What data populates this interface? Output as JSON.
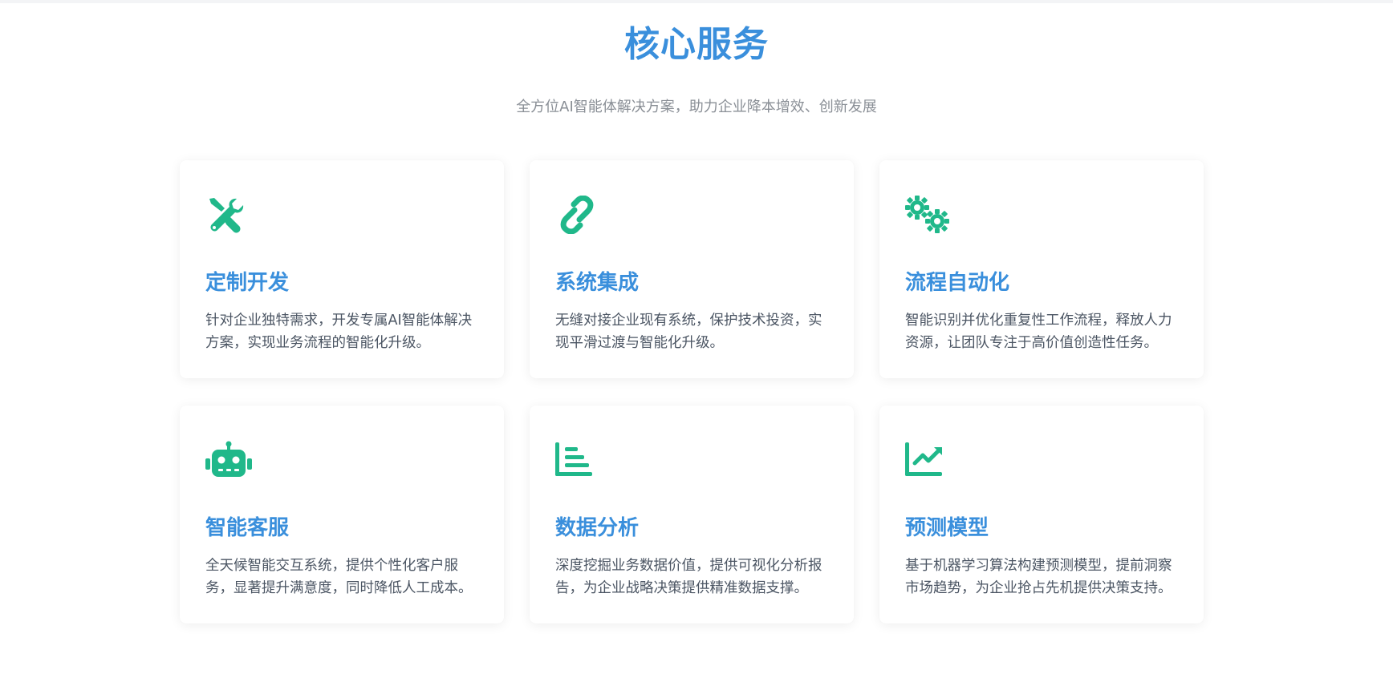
{
  "section": {
    "title": "核心服务",
    "subtitle": "全方位AI智能体解决方案，助力企业降本增效、创新发展"
  },
  "accent_color": "#3a8fdc",
  "icon_color": "#20b88a",
  "services": [
    {
      "icon": "tools-icon",
      "title": "定制开发",
      "description": "针对企业独特需求，开发专属AI智能体解决方案，实现业务流程的智能化升级。"
    },
    {
      "icon": "link-icon",
      "title": "系统集成",
      "description": "无缝对接企业现有系统，保护技术投资，实现平滑过渡与智能化升级。"
    },
    {
      "icon": "gears-icon",
      "title": "流程自动化",
      "description": "智能识别并优化重复性工作流程，释放人力资源，让团队专注于高价值创造性任务。"
    },
    {
      "icon": "robot-icon",
      "title": "智能客服",
      "description": "全天候智能交互系统，提供个性化客户服务，显著提升满意度，同时降低人工成本。"
    },
    {
      "icon": "bar-chart-icon",
      "title": "数据分析",
      "description": "深度挖掘业务数据价值，提供可视化分析报告，为企业战略决策提供精准数据支撑。"
    },
    {
      "icon": "line-chart-icon",
      "title": "预测模型",
      "description": "基于机器学习算法构建预测模型，提前洞察市场趋势，为企业抢占先机提供决策支持。"
    }
  ]
}
